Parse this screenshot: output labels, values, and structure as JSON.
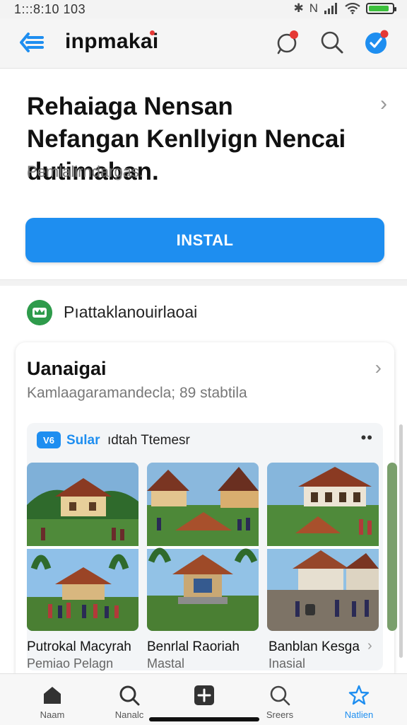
{
  "status_bar": {
    "time": "1:::8:10 103",
    "network": "N"
  },
  "app": {
    "title": "inpmakai"
  },
  "hero": {
    "title": "Rehaiaga Nensan Nefangan Kenllyign Nencai dutimaban.",
    "subtitle": "Pemlalirndargas.",
    "install_label": "INSTAL"
  },
  "section": {
    "title": "Pıattaklanouirlaoai"
  },
  "card": {
    "title": "Uanaigai",
    "subtitle": "Kamlaagaramandecla; 89 stabtila",
    "inner": {
      "badge": "V6",
      "brand": "Sular",
      "label": "ıdtah Ttemesr",
      "more": "••"
    },
    "tiles": [
      {
        "name": "Putrokal Macyrah",
        "sub": "Pemiao Pelagn"
      },
      {
        "name": "Benrlal Raoriah",
        "sub": "Mastal"
      },
      {
        "name": "Banblan Kesga",
        "sub": "Inasial"
      }
    ]
  },
  "bottom_nav": [
    {
      "label": "Naam",
      "icon": "home-icon"
    },
    {
      "label": "Nanalc",
      "icon": "search-icon"
    },
    {
      "label": "",
      "icon": "add-icon"
    },
    {
      "label": "Sreers",
      "icon": "search-icon"
    },
    {
      "label": "Natlien",
      "icon": "star-icon",
      "active": true
    }
  ],
  "colors": {
    "accent": "#1e8ef0",
    "notification": "#e53935",
    "section_icon": "#2e9b4b"
  }
}
